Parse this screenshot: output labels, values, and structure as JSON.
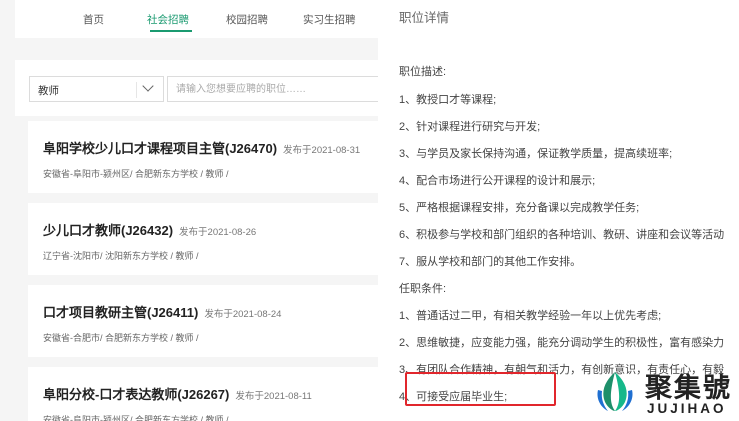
{
  "nav": {
    "items": [
      {
        "label": "首页"
      },
      {
        "label": "社会招聘"
      },
      {
        "label": "校园招聘"
      },
      {
        "label": "实习生招聘"
      }
    ],
    "active": "社会招聘"
  },
  "filter": {
    "select_value": "教师",
    "search_placeholder": "请输入您想要应聘的职位……"
  },
  "jobs": [
    {
      "title": "阜阳学校少儿口才课程项目主管(J26470)",
      "date": "发布于2021-08-31",
      "meta": "安徽省-阜阳市-颍州区/ 合肥新东方学校 / 教师 /"
    },
    {
      "title": "少儿口才教师(J26432)",
      "date": "发布于2021-08-26",
      "meta": "辽宁省-沈阳市/ 沈阳新东方学校 / 教师 /"
    },
    {
      "title": "口才项目教研主管(J26411)",
      "date": "发布于2021-08-24",
      "meta": "安徽省-合肥市/ 合肥新东方学校 / 教师 /"
    },
    {
      "title": "阜阳分校-口才表达教师(J26267)",
      "date": "发布于2021-08-11",
      "meta": "安徽省-阜阳市-颍州区/ 合肥新东方学校 / 教师 /"
    }
  ],
  "detail": {
    "title": "职位详情",
    "description_heading": "职位描述:",
    "description": [
      "1、教授口才等课程;",
      "2、针对课程进行研究与开发;",
      "3、与学员及家长保持沟通，保证教学质量，提高续班率;",
      "4、配合市场进行公开课程的设计和展示;",
      "5、严格根据课程安排，充分备课以完成教学任务;",
      "6、积极参与学校和部门组织的各种培训、教研、讲座和会议等活动",
      "7、服从学校和部门的其他工作安排。"
    ],
    "requirements_heading": "任职条件:",
    "requirements": [
      "1、普通话过二甲，有相关教学经验一年以上优先考虑;",
      "2、思维敏捷，应变能力强，能充分调动学生的积极性，富有感染力",
      "3、有团队合作精神，有朝气和活力，有创新意识，有责任心，有毅",
      "4、可接受应届毕业生;"
    ]
  },
  "logo": {
    "name": "聚集號",
    "sub": "JUJIHAO"
  },
  "colors": {
    "accent": "#1a9a70",
    "highlight": "#e1262c"
  }
}
